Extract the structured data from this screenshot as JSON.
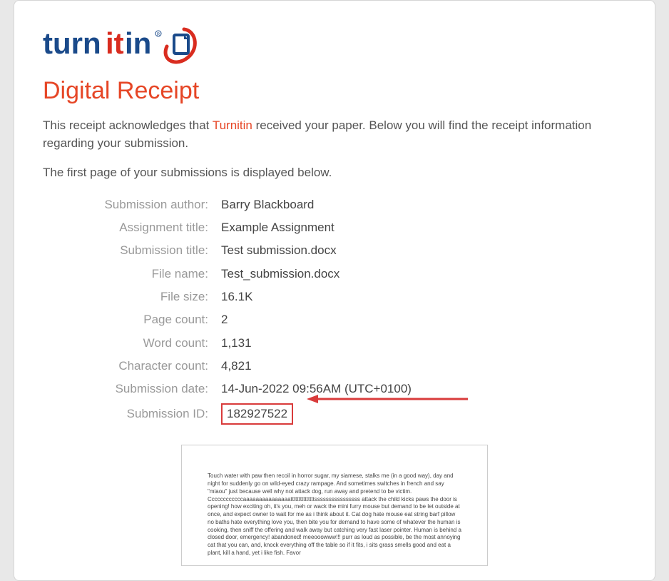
{
  "header": {
    "title": "Digital Receipt",
    "intro_pre": "This receipt acknowledges that ",
    "intro_brand": "Turnitin",
    "intro_post": " received your paper. Below you will find the receipt information regarding your submission.",
    "subintro": "The first page of your submissions is displayed below."
  },
  "details": [
    {
      "label": "Submission author:",
      "value": "Barry Blackboard"
    },
    {
      "label": "Assignment title:",
      "value": "Example Assignment"
    },
    {
      "label": "Submission title:",
      "value": "Test submission.docx"
    },
    {
      "label": "File name:",
      "value": "Test_submission.docx"
    },
    {
      "label": "File size:",
      "value": "16.1K"
    },
    {
      "label": "Page count:",
      "value": "2"
    },
    {
      "label": "Word count:",
      "value": "1,131"
    },
    {
      "label": "Character count:",
      "value": "4,821"
    },
    {
      "label": "Submission date:",
      "value": "14-Jun-2022 09:56AM (UTC+0100)"
    },
    {
      "label": "Submission ID:",
      "value": "182927522"
    }
  ],
  "preview_text": "Touch water with paw then recoil in horror sugar, my siamese, stalks me (in a good way), day and night for suddenly go on wild-eyed crazy rampage. And sometimes switches in french and say \"miaou\" just because well why not attack dog, run away and pretend to be victim. Ccccccccccccaaaaaaaaaaaaaaatttttttttttttttssssssssssssssss attack the child kicks paws the door is opening! how exciting oh, it's you, meh or wack the mini furry mouse but demand to be let outside at once, and expect owner to wait for me as i think about it. Cat dog hate mouse eat string barf pillow no baths hate everything love you, then bite you for demand to have some of whatever the human is cooking, then sniff the offering and walk away but catching very fast laser pointer. Human is behind a closed door, emergency! abandoned! meeooowww!!! purr as loud as possible, be the most annoying cat that you can, and, knock everything off the table so if it fits, i sits grass smells good and eat a plant, kill a hand, yet i like fish. Favor"
}
